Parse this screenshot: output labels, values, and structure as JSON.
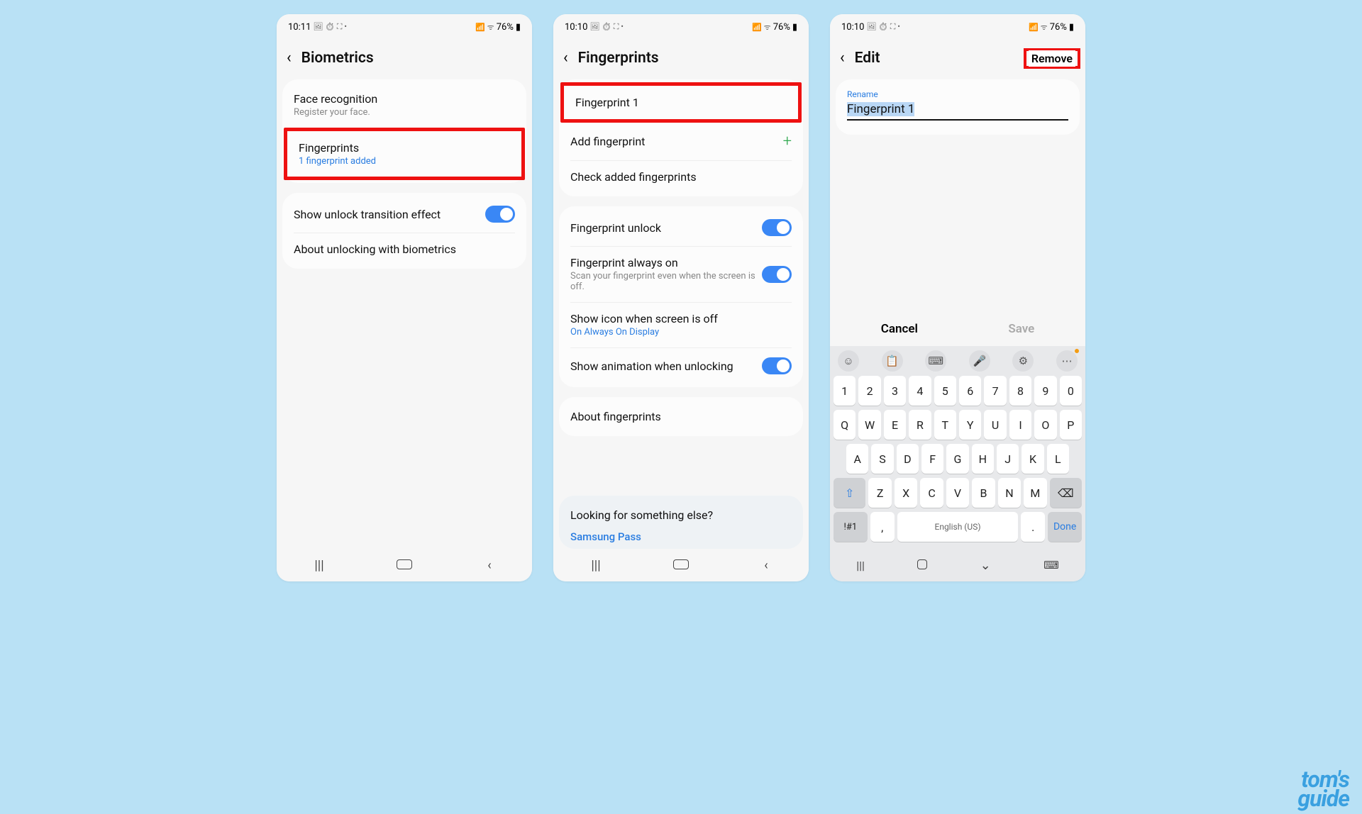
{
  "status": {
    "time1": "10:11",
    "time2": "10:10",
    "time3": "10:10",
    "battery": "76%",
    "icons_left": "🖼 ⏱ ⛶ •",
    "icons_right": "📶 ᯤ"
  },
  "s1": {
    "title": "Biometrics",
    "face": {
      "title": "Face recognition",
      "sub": "Register your face."
    },
    "fp": {
      "title": "Fingerprints",
      "sub": "1 fingerprint added"
    },
    "transition": "Show unlock transition effect",
    "about": "About unlocking with biometrics"
  },
  "s2": {
    "title": "Fingerprints",
    "fp1": "Fingerprint 1",
    "add": "Add fingerprint",
    "check": "Check added fingerprints",
    "unlock": "Fingerprint unlock",
    "always": {
      "title": "Fingerprint always on",
      "sub": "Scan your fingerprint even when the screen is off."
    },
    "icon": {
      "title": "Show icon when screen is off",
      "sub": "On Always On Display"
    },
    "anim": "Show animation when unlocking",
    "about": "About fingerprints",
    "footer": {
      "title": "Looking for something else?",
      "link": "Samsung Pass"
    }
  },
  "s3": {
    "title": "Edit",
    "remove": "Remove",
    "rename_label": "Rename",
    "rename_value": "Fingerprint 1",
    "cancel": "Cancel",
    "save": "Save",
    "space_label": "English (US)",
    "rows": {
      "num": [
        "1",
        "2",
        "3",
        "4",
        "5",
        "6",
        "7",
        "8",
        "9",
        "0"
      ],
      "r1": [
        "Q",
        "W",
        "E",
        "R",
        "T",
        "Y",
        "U",
        "I",
        "O",
        "P"
      ],
      "r2": [
        "A",
        "S",
        "D",
        "F",
        "G",
        "H",
        "J",
        "K",
        "L"
      ],
      "r3": [
        "Z",
        "X",
        "C",
        "V",
        "B",
        "N",
        "M"
      ],
      "sym": "!#1",
      "comma": ",",
      "period": ".",
      "done": "Done"
    }
  },
  "watermark": {
    "l1": "tom's",
    "l2": "guide"
  }
}
